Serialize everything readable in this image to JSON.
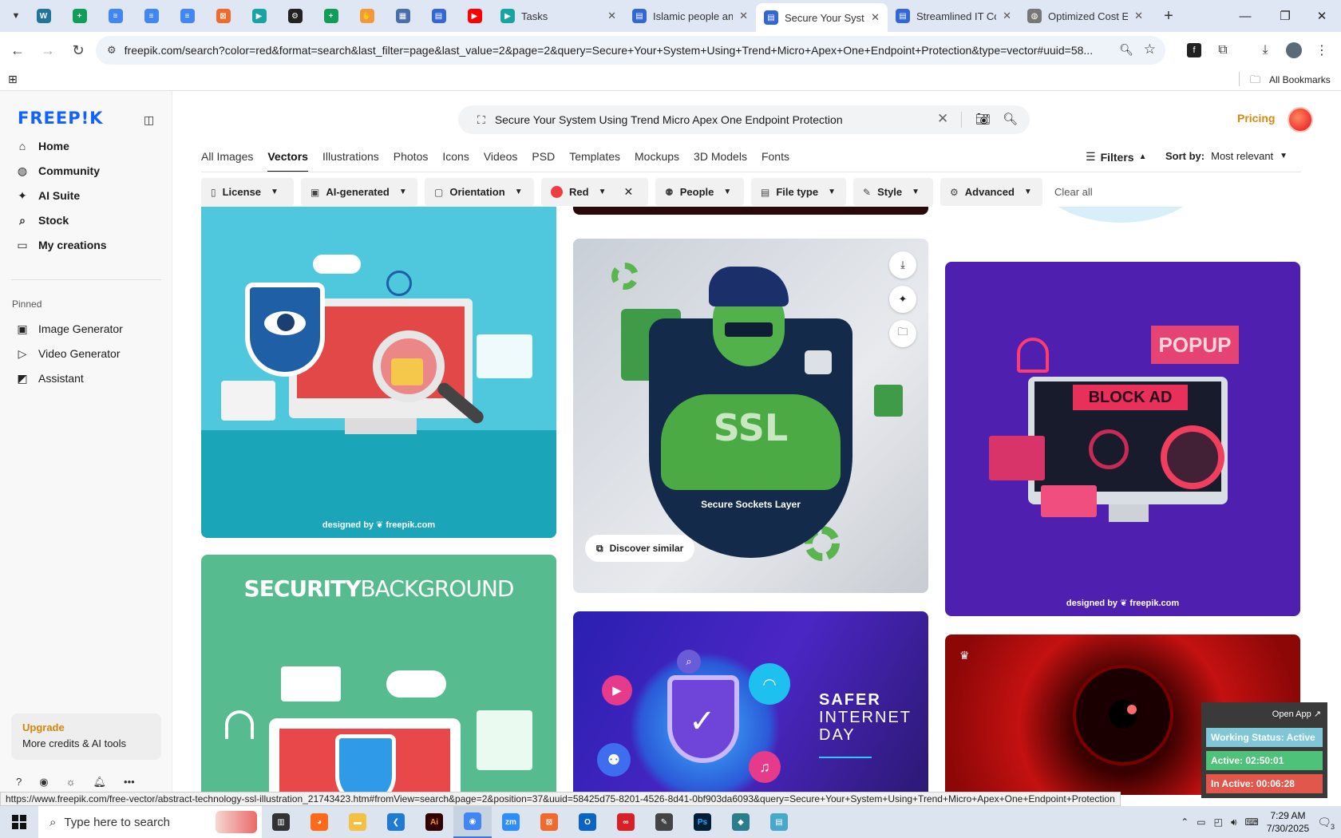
{
  "browser": {
    "pinned_tabs": [
      {
        "icon": "wordpress-icon",
        "color": "#21759b"
      },
      {
        "icon": "sheets-icon",
        "color": "#0f9d58"
      },
      {
        "icon": "docs-icon",
        "color": "#4285f4"
      },
      {
        "icon": "docs-icon",
        "color": "#4285f4"
      },
      {
        "icon": "docs-icon",
        "color": "#4285f4"
      },
      {
        "icon": "orange-square-icon",
        "color": "#f06a2b"
      },
      {
        "icon": "teal-arrow-icon",
        "color": "#1aa3a3"
      },
      {
        "icon": "openai-icon",
        "color": "#222222"
      },
      {
        "icon": "sheets-icon",
        "color": "#0f9d58"
      },
      {
        "icon": "hand-icon",
        "color": "#f29a3a"
      },
      {
        "icon": "grid-doc-icon",
        "color": "#4a6ea9"
      },
      {
        "icon": "forms-icon",
        "color": "#3367d6"
      },
      {
        "icon": "youtube-icon",
        "color": "#ff0000"
      }
    ],
    "tabs": [
      {
        "title": "Tasks",
        "icon": "teal-arrow-icon",
        "active": false
      },
      {
        "title": "Islamic people an",
        "icon": "forms-icon",
        "active": false
      },
      {
        "title": "Secure Your Syste",
        "icon": "forms-icon",
        "active": true
      },
      {
        "title": "Streamlined IT Co",
        "icon": "forms-icon",
        "active": false
      },
      {
        "title": "Optimized Cost E",
        "icon": "globe-icon",
        "active": false
      }
    ],
    "url": "freepik.com/search?color=red&format=search&last_filter=page&last_value=2&page=2&query=Secure+Your+System+Using+Trend+Micro+Apex+One+Endpoint+Protection&type=vector#uuid=58...",
    "bookmarks_label": "All Bookmarks",
    "status_url": "https://www.freepik.com/free-vector/abstract-technology-ssl-illustration_21743423.htm#fromView=search&page=2&position=37&uuid=58425d75-8201-4526-8d41-0bf903da6093&query=Secure+Your+System+Using+Trend+Micro+Apex+One+Endpoint+Protection"
  },
  "sidebar": {
    "logo": "FREEP!K",
    "nav": [
      {
        "label": "Home",
        "icon": "home-icon"
      },
      {
        "label": "Community",
        "icon": "globe-icon"
      },
      {
        "label": "AI Suite",
        "icon": "sparkle-icon"
      },
      {
        "label": "Stock",
        "icon": "search-icon"
      },
      {
        "label": "My creations",
        "icon": "folder-icon"
      }
    ],
    "pinned_heading": "Pinned",
    "pinned": [
      {
        "label": "Image Generator",
        "icon": "image-icon"
      },
      {
        "label": "Video Generator",
        "icon": "video-icon"
      },
      {
        "label": "Assistant",
        "icon": "chat-icon"
      }
    ],
    "upgrade": {
      "title": "Upgrade",
      "subtitle": "More credits & AI tools"
    }
  },
  "header": {
    "search_query": "Secure Your System Using Trend Micro Apex One Endpoint Protection",
    "pricing": "Pricing"
  },
  "type_tabs": [
    "All Images",
    "Vectors",
    "Illustrations",
    "Photos",
    "Icons",
    "Videos",
    "PSD",
    "Templates",
    "Mockups",
    "3D Models",
    "Fonts"
  ],
  "active_type_tab": "Vectors",
  "filters_label": "Filters",
  "sort": {
    "label": "Sort by:",
    "value": "Most relevant"
  },
  "chips": {
    "license": "License",
    "ai": "AI-generated",
    "orientation": "Orientation",
    "color": "Red",
    "people": "People",
    "filetype": "File type",
    "style": "Style",
    "advanced": "Advanced",
    "clear": "Clear all"
  },
  "cards": {
    "credit": "designed by ❦ freepik.com",
    "security_title_bold": "SECURITY",
    "security_title_light": "BACKGROUND",
    "ssl_text": "SSL",
    "ssl_caption": "Secure Sockets Layer",
    "discover_similar": "Discover similar",
    "popup_text": "POPUP",
    "blockad_text": "BLOCK AD",
    "safer_1": "SAFER",
    "safer_2": "INTERNET",
    "safer_3": "DAY"
  },
  "widget": {
    "open_app": "Open App ↗",
    "status": "Working Status: Active",
    "active": "Active: 02:50:01",
    "inactive": "In Active: 00:06:28",
    "colors": {
      "status": "#7fc7d6",
      "active": "#4fc27a",
      "inactive": "#e2574c"
    }
  },
  "taskbar": {
    "search_placeholder": "Type here to search",
    "time": "7:29 AM",
    "date": "7/30/2025",
    "notification_count": "3",
    "apps": [
      {
        "icon": "task-view-icon",
        "color": "#333333"
      },
      {
        "icon": "firefox-icon",
        "color": "#ff6a1a"
      },
      {
        "icon": "file-explorer-icon",
        "color": "#f5c142"
      },
      {
        "icon": "vscode-icon",
        "color": "#1f7ad4"
      },
      {
        "icon": "illustrator-icon",
        "color": "#330000"
      },
      {
        "icon": "chrome-icon",
        "color": "#4285f4"
      },
      {
        "icon": "zoom-icon",
        "color": "#2d8cff"
      },
      {
        "icon": "orange-app-icon",
        "color": "#f06a2b"
      },
      {
        "icon": "outlook-icon",
        "color": "#0a64c8"
      },
      {
        "icon": "creative-cloud-icon",
        "color": "#da1f26"
      },
      {
        "icon": "pen-icon",
        "color": "#444444"
      },
      {
        "icon": "photoshop-icon",
        "color": "#001e36"
      },
      {
        "icon": "cube-app-icon",
        "color": "#2a7d8c"
      },
      {
        "icon": "notepad-icon",
        "color": "#47a8c9"
      }
    ]
  }
}
